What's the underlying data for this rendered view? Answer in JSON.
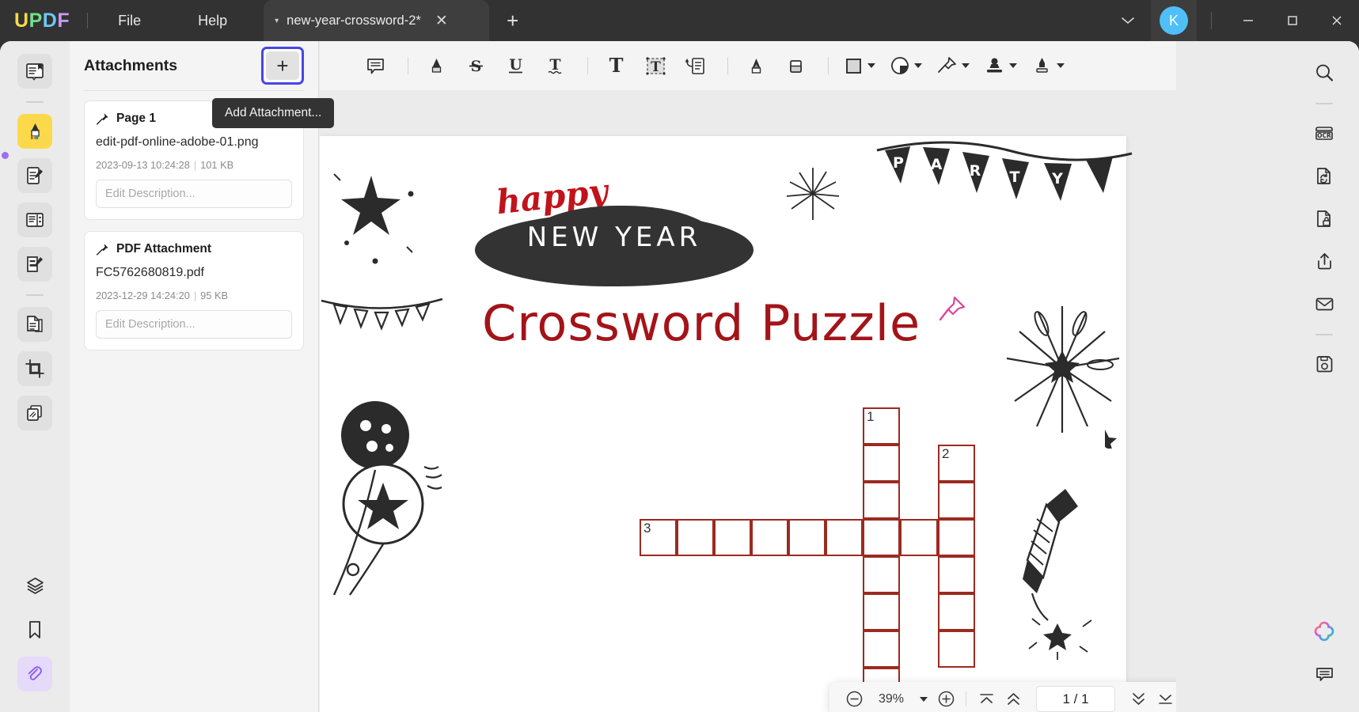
{
  "window": {
    "logo": {
      "u": "U",
      "p": "P",
      "d": "D",
      "f": "F"
    },
    "menus": [
      {
        "name": "file-menu",
        "label": "File"
      },
      {
        "name": "help-menu",
        "label": "Help"
      }
    ],
    "tab": {
      "title": "new-year-crossword-2*",
      "close_label": "✕",
      "caret": "▾"
    },
    "new_tab_label": "+",
    "account_initial": "K",
    "account_color": "#4ec0f7",
    "controls": {
      "chevron": "⌄",
      "minimize": "—",
      "maximize": "☐",
      "close": "✕"
    }
  },
  "left_rail": {
    "items": [
      {
        "name": "sidebar-reader-icon",
        "label": "Reader",
        "icon": "book-bookmark-icon",
        "state": "normal"
      },
      {
        "name": "sidebar-annotate-icon",
        "label": "Annotate",
        "icon": "highlighter-icon",
        "state": "active"
      },
      {
        "name": "sidebar-edit-pdf-icon",
        "label": "Edit PDF",
        "icon": "document-pencil-icon",
        "state": "normal"
      },
      {
        "name": "sidebar-page-tools-icon",
        "label": "Page Tools",
        "icon": "page-organize-icon",
        "state": "normal"
      },
      {
        "name": "sidebar-form-icon",
        "label": "Form",
        "icon": "form-edit-icon",
        "state": "normal"
      },
      {
        "name": "sidebar-convert-icon",
        "label": "Convert",
        "icon": "document-copy-icon",
        "state": "normal"
      },
      {
        "name": "sidebar-crop-icon",
        "label": "Crop",
        "icon": "crop-icon",
        "state": "normal"
      },
      {
        "name": "sidebar-compare-icon",
        "label": "Compare",
        "icon": "compare-pages-icon",
        "state": "normal"
      }
    ],
    "bottom_items": [
      {
        "name": "sidebar-layers-icon",
        "label": "Layers",
        "icon": "layers-icon",
        "state": "plain"
      },
      {
        "name": "sidebar-bookmarks-icon",
        "label": "Bookmarks",
        "icon": "bookmark-icon",
        "state": "plain"
      },
      {
        "name": "sidebar-attachments-icon",
        "label": "Attachments",
        "icon": "paperclip-icon",
        "state": "purple-active"
      }
    ]
  },
  "panel": {
    "title": "Attachments",
    "add_button": {
      "label": "+",
      "name": "add-attachment-button"
    },
    "tooltip": "Add Attachment...",
    "attachments": [
      {
        "pin_label": "Page 1",
        "filename": "edit-pdf-online-adobe-01.png",
        "date": "2023-09-13 10:24:28",
        "separator": "|",
        "size": "101 KB",
        "description": "",
        "description_placeholder": "Edit Description..."
      },
      {
        "pin_label": "PDF Attachment",
        "filename": "FC5762680819.pdf",
        "date": "2023-12-29 14:24:20",
        "separator": "|",
        "size": "95 KB",
        "description": "",
        "description_placeholder": "Edit Description..."
      }
    ]
  },
  "toolbar": {
    "items": [
      {
        "name": "note-tool",
        "label": "Note",
        "icon": "comment-note-icon",
        "dropdown": false
      },
      {
        "name": "highlight-tool",
        "label": "Highlight",
        "icon": "highlighter-icon",
        "dropdown": false
      },
      {
        "name": "strikethrough-tool",
        "label": "Strikethrough",
        "icon": "strikethrough-S-icon",
        "glyph": "S",
        "dropdown": false
      },
      {
        "name": "underline-tool",
        "label": "Underline",
        "icon": "underline-U-icon",
        "glyph": "U",
        "dropdown": false
      },
      {
        "name": "squiggly-tool",
        "label": "Squiggly",
        "icon": "squiggly-T-icon",
        "glyph": "T",
        "dropdown": false
      },
      {
        "name": "text-tool",
        "label": "Text",
        "icon": "text-T-icon",
        "glyph": "T",
        "dropdown": false
      },
      {
        "name": "text-box-tool",
        "label": "Text Box",
        "icon": "textbox-T-icon",
        "glyph": "T",
        "dropdown": false
      },
      {
        "name": "callout-tool",
        "label": "Text Callout",
        "icon": "callout-icon",
        "dropdown": false
      },
      {
        "name": "pencil-tool",
        "label": "Pencil",
        "icon": "pencil-icon",
        "dropdown": false
      },
      {
        "name": "eraser-tool",
        "label": "Eraser",
        "icon": "eraser-icon",
        "dropdown": false
      },
      {
        "name": "shapes-tool",
        "label": "Shapes",
        "icon": "square-shape-icon",
        "dropdown": true
      },
      {
        "name": "sticker-tool",
        "label": "Sticker",
        "icon": "sticker-icon",
        "dropdown": true
      },
      {
        "name": "stamp-pin-tool",
        "label": "Stamp",
        "icon": "pushpin-icon",
        "dropdown": true
      },
      {
        "name": "signature-tool",
        "label": "Stamp Tool",
        "icon": "stamp-icon",
        "dropdown": true
      },
      {
        "name": "sign-tool",
        "label": "Sign",
        "icon": "fountain-pen-icon",
        "dropdown": true
      }
    ]
  },
  "document": {
    "happy": "happy",
    "new_year": "NEW  YEAR",
    "title": "Crossword Puzzle",
    "party_letters": [
      "P",
      "A",
      "R",
      "T",
      "Y"
    ],
    "crossword_numbers": [
      "1",
      "2",
      "3"
    ]
  },
  "floatbar": {
    "zoom_out": "−",
    "zoom_value": "39%",
    "zoom_caret": "▾",
    "zoom_in": "+",
    "first_page": "first-page",
    "prev_page": "prev-page",
    "page_indicator": "1 / 1",
    "next_page": "next-page",
    "last_page": "last-page",
    "close": "✕"
  },
  "right_rail": {
    "items": [
      {
        "name": "search-icon",
        "label": "Search",
        "icon": "magnifier-icon"
      },
      {
        "name": "ocr-icon",
        "label": "OCR",
        "icon": "ocr-icon",
        "text": "OCR"
      },
      {
        "name": "convert-icon",
        "label": "Convert",
        "icon": "document-refresh-icon"
      },
      {
        "name": "protect-icon",
        "label": "Protect",
        "icon": "document-lock-icon"
      },
      {
        "name": "share-icon",
        "label": "Share",
        "icon": "share-upload-icon"
      },
      {
        "name": "email-icon",
        "label": "Email",
        "icon": "envelope-icon"
      },
      {
        "name": "save-icon",
        "label": "Save",
        "icon": "floppy-save-icon"
      }
    ],
    "bottom_items": [
      {
        "name": "ai-assistant-icon",
        "label": "AI Assistant",
        "icon": "ai-flower-icon"
      },
      {
        "name": "comments-icon",
        "label": "Comments",
        "icon": "comment-list-icon"
      }
    ]
  }
}
